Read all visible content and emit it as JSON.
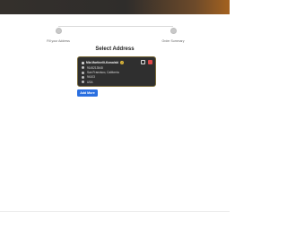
{
  "stepper": {
    "steps": [
      {
        "label": "Fill your Address"
      },
      {
        "label": "Order Summary"
      }
    ]
  },
  "page": {
    "title": "Select Address"
  },
  "address_card": {
    "name": "Mia Martinelli-Kowalski",
    "rows": [
      {
        "icon": "phone-icon",
        "text": "9145213548"
      },
      {
        "icon": "location-icon",
        "text": "San Francisco, California"
      },
      {
        "icon": "postal-icon",
        "text": "94103"
      },
      {
        "icon": "globe-icon",
        "text": "USA"
      }
    ]
  },
  "actions": {
    "add_more_label": "Add More"
  },
  "colors": {
    "banner_dark": "#2f2d2b",
    "banner_accent": "#a4621f",
    "card_bg": "#2f2f2f",
    "primary_button": "#2a6fe0",
    "delete_red": "#e04a4a"
  }
}
